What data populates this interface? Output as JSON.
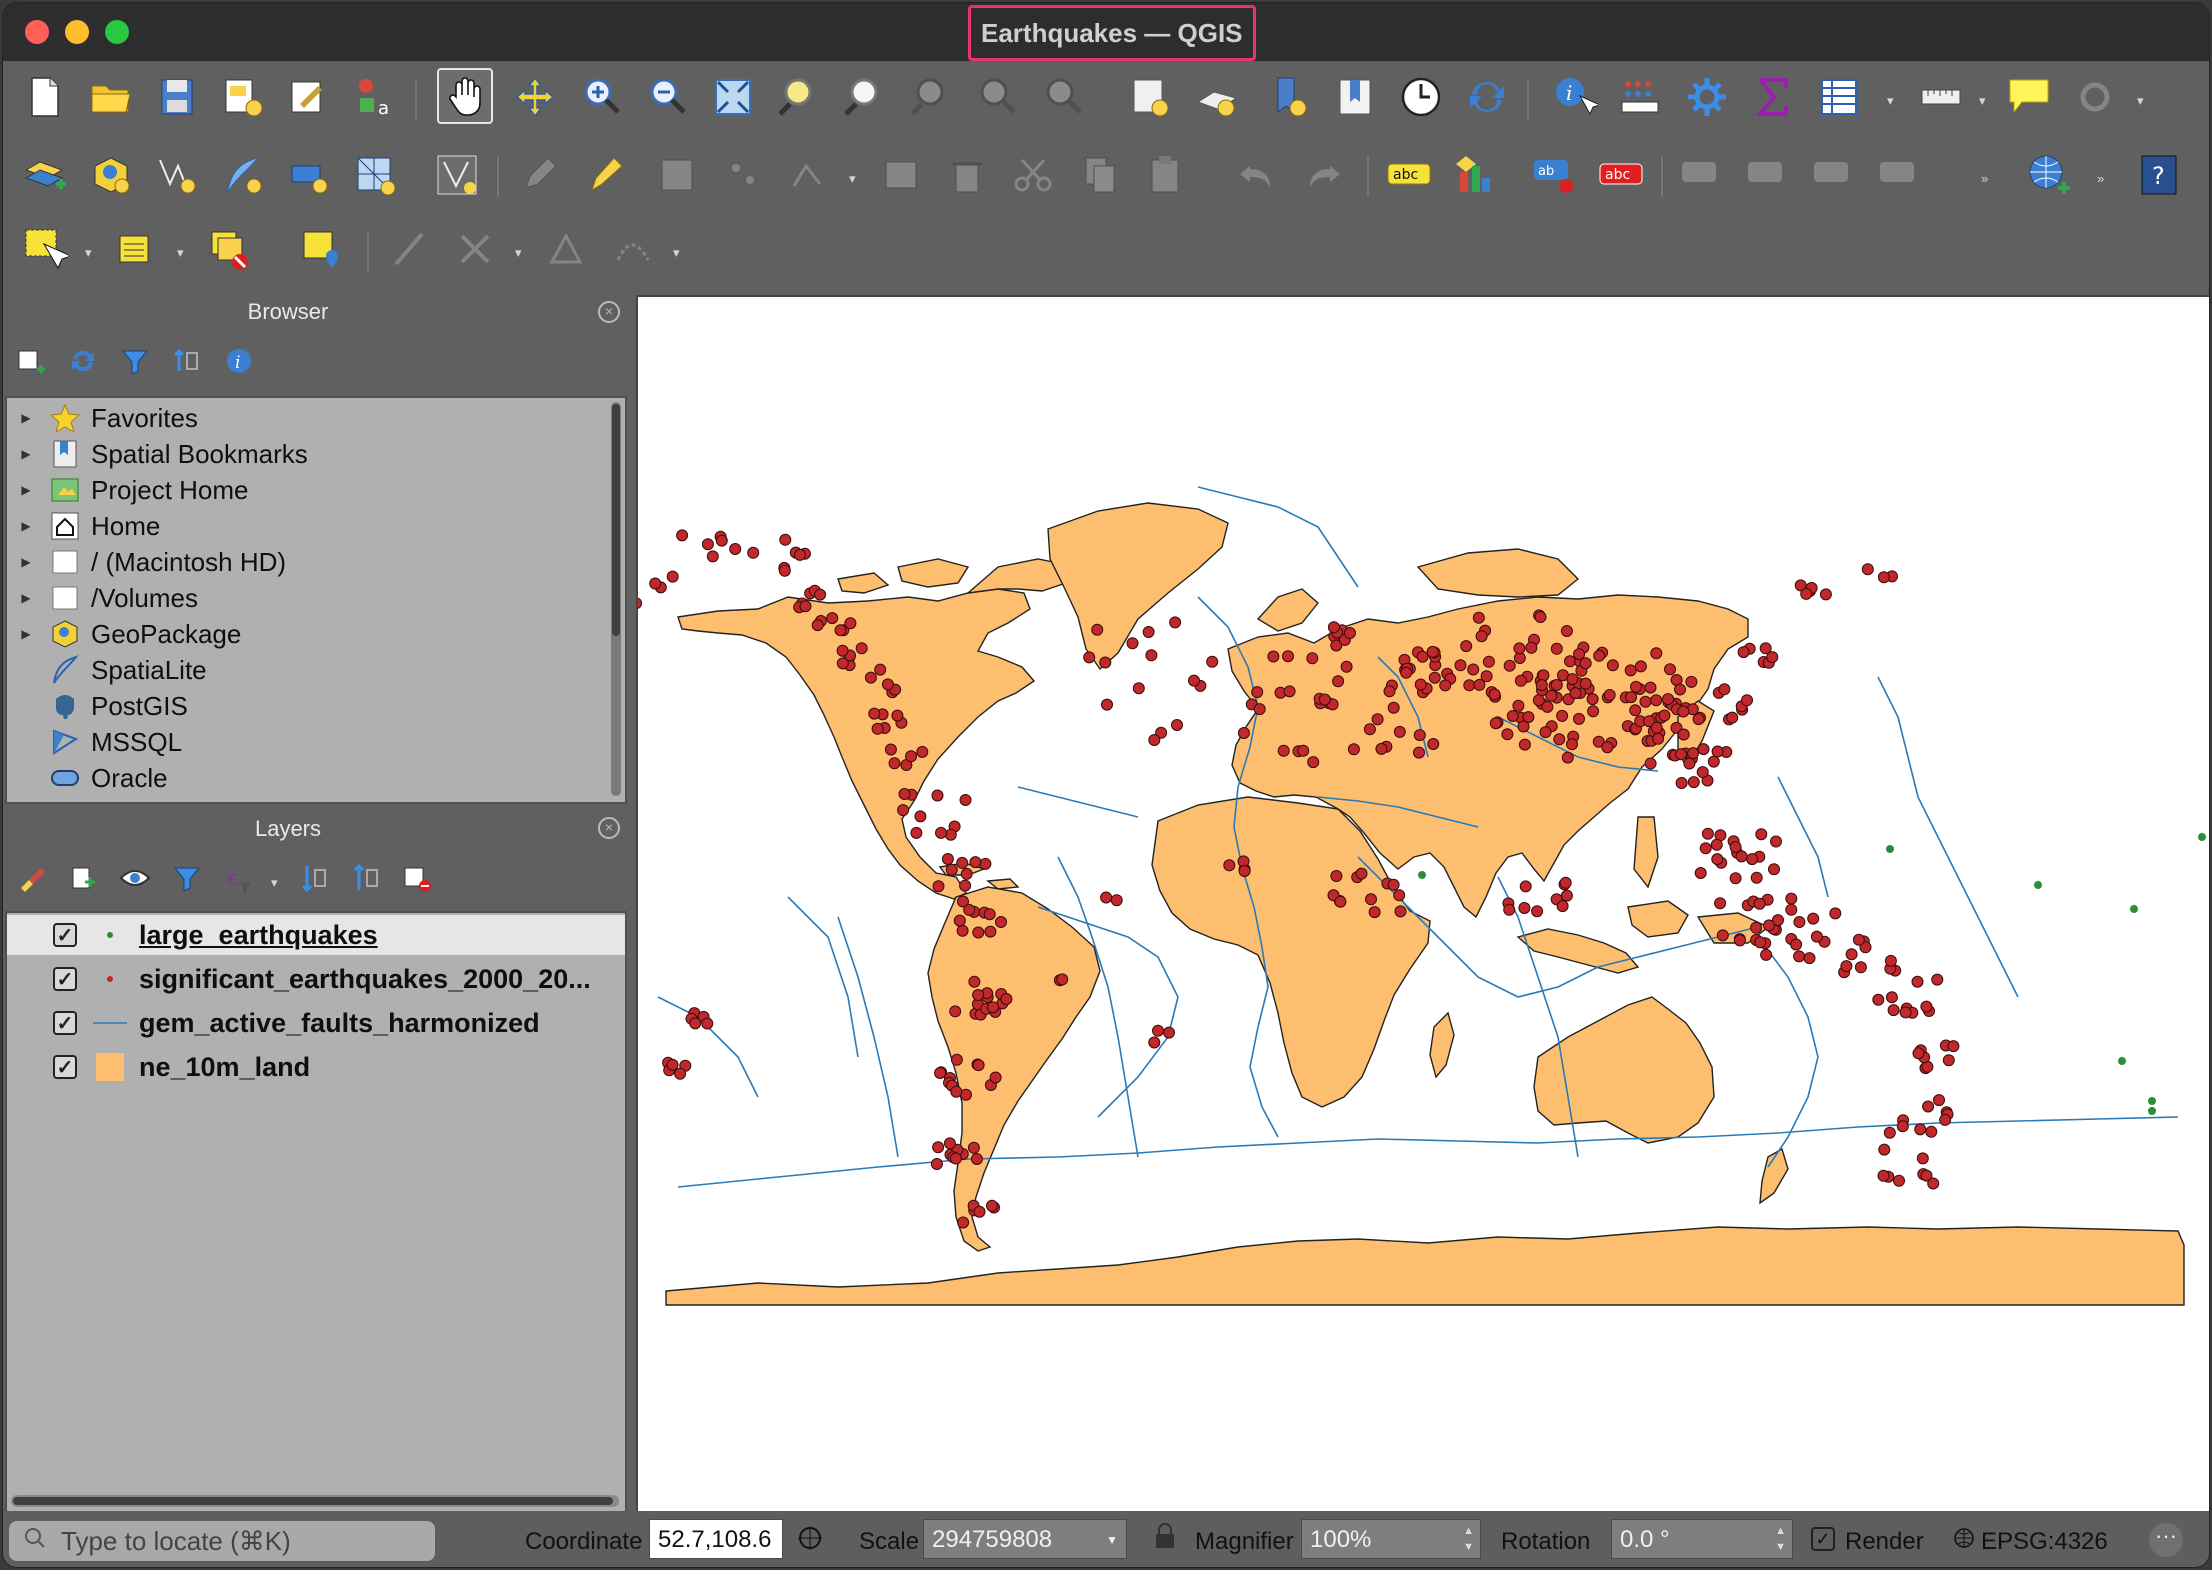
{
  "window": {
    "title": "Earthquakes — QGIS"
  },
  "browser": {
    "title": "Browser",
    "items": [
      {
        "label": "Favorites",
        "icon": "star-icon"
      },
      {
        "label": "Spatial Bookmarks",
        "icon": "bookmark-icon"
      },
      {
        "label": "Project Home",
        "icon": "project-home-icon"
      },
      {
        "label": "Home",
        "icon": "home-icon"
      },
      {
        "label": "/ (Macintosh HD)",
        "icon": "folder-icon"
      },
      {
        "label": "/Volumes",
        "icon": "folder-icon"
      },
      {
        "label": "GeoPackage",
        "icon": "geopackage-icon"
      },
      {
        "label": "SpatiaLite",
        "icon": "feather-icon"
      },
      {
        "label": "PostGIS",
        "icon": "elephant-icon"
      },
      {
        "label": "MSSQL",
        "icon": "mssql-icon"
      },
      {
        "label": "Oracle",
        "icon": "database-icon"
      }
    ]
  },
  "layers": {
    "title": "Layers",
    "items": [
      {
        "label": "large_earthquakes",
        "checked": true,
        "symbol": "green-dot",
        "color": "#2e8b3a"
      },
      {
        "label": "significant_earthquakes_2000_20...",
        "checked": true,
        "symbol": "red-dot",
        "color": "#c0282b"
      },
      {
        "label": "gem_active_faults_harmonized",
        "checked": true,
        "symbol": "blue-line",
        "color": "#2a7ab8"
      },
      {
        "label": "ne_10m_land",
        "checked": true,
        "symbol": "orange-fill",
        "color": "#fdbf6f"
      }
    ]
  },
  "status": {
    "locate_placeholder": "Type to locate (⌘K)",
    "coordinate_label": "Coordinate",
    "coordinate_value": "52.7,108.6",
    "scale_label": "Scale",
    "scale_value": "294759808",
    "magnifier_label": "Magnifier",
    "magnifier_value": "100%",
    "rotation_label": "Rotation",
    "rotation_value": "0.0 °",
    "render_label": "Render",
    "crs_label": "EPSG:4326"
  },
  "colors": {
    "land": "#fdbf6f",
    "faults": "#2a7ab8",
    "quake": "#c0282b",
    "large_quake": "#2e8b3a",
    "title_highlight": "#e8336b"
  }
}
